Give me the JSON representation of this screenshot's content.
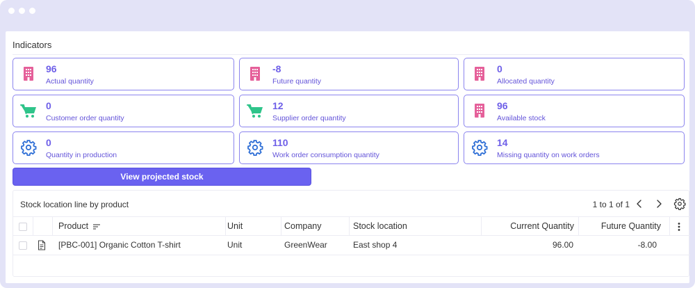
{
  "section": {
    "title": "Indicators"
  },
  "cards": [
    {
      "value": "96",
      "label": "Actual quantity",
      "icon": "building-icon"
    },
    {
      "value": "-8",
      "label": "Future quantity",
      "icon": "building-icon"
    },
    {
      "value": "0",
      "label": "Allocated quantity",
      "icon": "building-icon"
    },
    {
      "value": "0",
      "label": "Customer order quantity",
      "icon": "cart-icon"
    },
    {
      "value": "12",
      "label": "Supplier order quantity",
      "icon": "cart-icon"
    },
    {
      "value": "96",
      "label": "Available stock",
      "icon": "building-icon"
    },
    {
      "value": "0",
      "label": "Quantity in production",
      "icon": "gear-icon"
    },
    {
      "value": "110",
      "label": "Work order consumption quantity",
      "icon": "gear-icon"
    },
    {
      "value": "14",
      "label": "Missing quantity on work orders",
      "icon": "gear-icon"
    }
  ],
  "actions": {
    "view_projected_stock": "View projected stock"
  },
  "table": {
    "title": "Stock location line by product",
    "pagination": "1 to 1 of 1",
    "columns": {
      "product": "Product",
      "unit": "Unit",
      "company": "Company",
      "stock_location": "Stock location",
      "current_quantity": "Current Quantity",
      "future_quantity": "Future Quantity"
    },
    "rows": [
      {
        "product": "[PBC-001] Organic Cotton T-shirt",
        "unit": "Unit",
        "company": "GreenWear",
        "stock_location": "East shop 4",
        "current_quantity": "96.00",
        "future_quantity": "-8.00"
      }
    ]
  },
  "colors": {
    "accent": "#6a62f0",
    "card_border": "#8b84ee",
    "building_icon": "#e5609a",
    "cart_icon": "#2fc48a",
    "gear_icon": "#2f6fd6",
    "frame": "#e3e3f7"
  }
}
